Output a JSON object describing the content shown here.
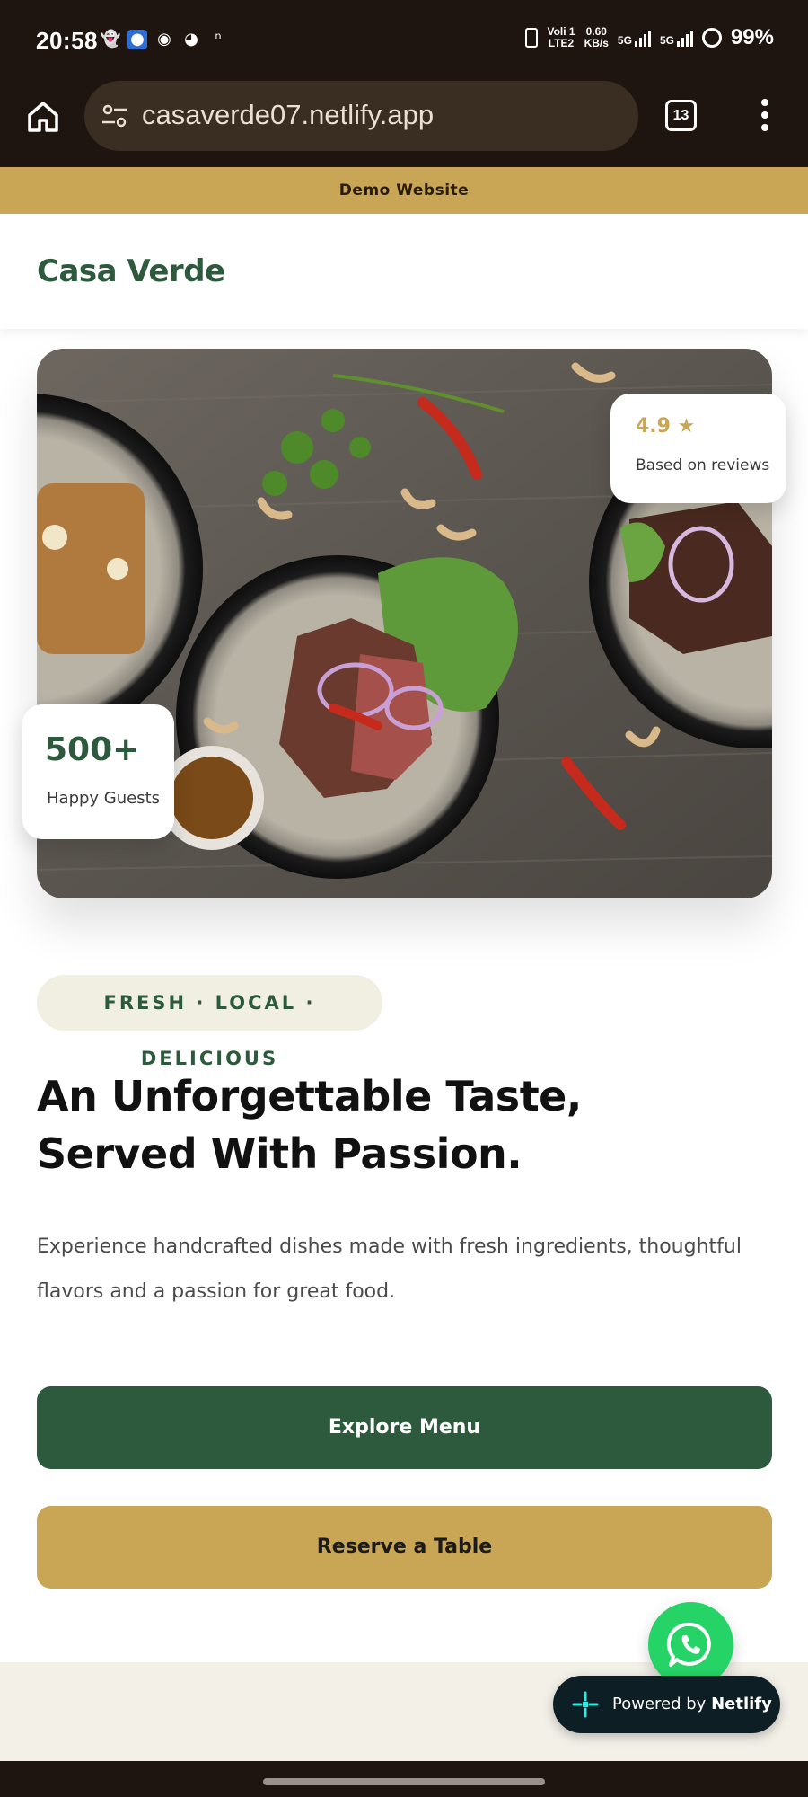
{
  "status_bar": {
    "time": "20:58",
    "network_top": "Voli 1",
    "network_bottom": "LTE2",
    "speed_top": "0.60",
    "speed_bottom": "KB/s",
    "net_a": "5G",
    "net_b": "5G",
    "battery": "99%"
  },
  "browser": {
    "url": "casaverde07.netlify.app",
    "tab_count": "13"
  },
  "demo_ribbon": "Demo Website",
  "header": {
    "brand": "Casa Verde"
  },
  "hero": {
    "rating_value": "4.9 ★",
    "rating_label": "Based on reviews",
    "guests_value": "500+",
    "guests_label": "Happy Guests"
  },
  "tagline": "FRESH · LOCAL · DELICIOUS",
  "headline": "An Unforgettable Taste, Served With Passion.",
  "subcopy": "Experience handcrafted dishes made with fresh ingredients, thoughtful flavors and a passion for great food.",
  "buttons": {
    "primary": "Explore Menu",
    "secondary": "Reserve a Table"
  },
  "netlify_badge": {
    "prefix": "Powered by ",
    "brand": "Netlify"
  },
  "colors": {
    "brand_green": "#2d5a3c",
    "brand_gold": "#c9a655",
    "browser_dark": "#1f1510",
    "whatsapp_green": "#25d366"
  }
}
